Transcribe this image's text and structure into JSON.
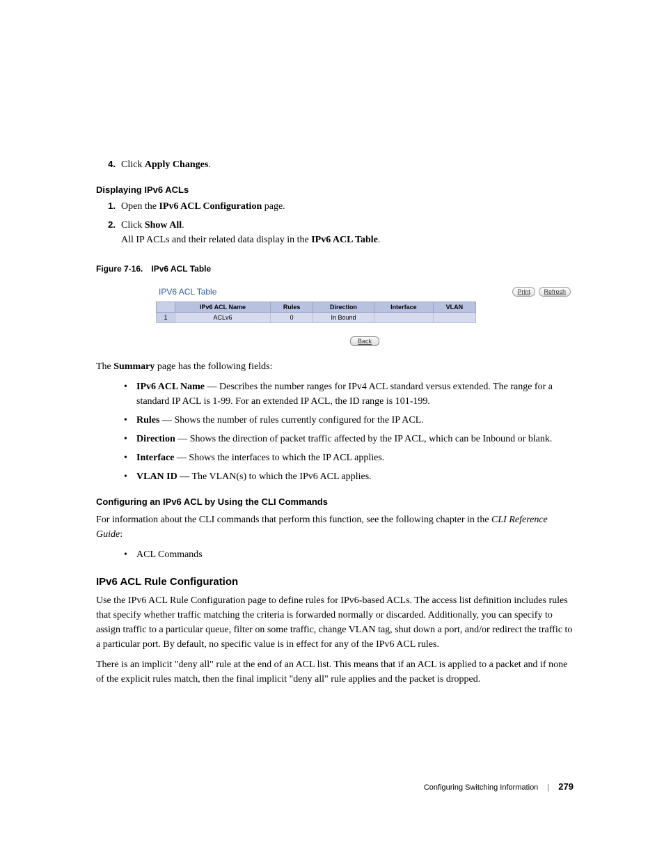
{
  "step4": {
    "num": "4.",
    "pre": "Click ",
    "bold": "Apply Changes",
    "post": "."
  },
  "h_display": "Displaying IPv6 ACLs",
  "ol1": {
    "num": "1.",
    "pre": "Open the ",
    "bold": "IPv6 ACL Configuration",
    "post": " page."
  },
  "ol2": {
    "num": "2.",
    "pre": "Click ",
    "bold": "Show All",
    "post": ".",
    "line2_pre": "All IP ACLs and their related data display in the ",
    "line2_bold": "IPv6 ACL Table",
    "line2_post": "."
  },
  "fig_caption": {
    "label": "Figure 7-16.",
    "title": "IPv6 ACL Table"
  },
  "figure": {
    "title": "IPV6 ACL Table",
    "print": "Print",
    "refresh": "Refresh",
    "headers": {
      "rownum": "",
      "name": "IPv6 ACL Name",
      "rules": "Rules",
      "direction": "Direction",
      "interface": "Interface",
      "vlan": "VLAN"
    },
    "row1": {
      "rownum": "1",
      "name": "ACLv6",
      "rules": "0",
      "direction": "In Bound",
      "interface": "",
      "vlan": ""
    },
    "back": "Back"
  },
  "summary_intro": {
    "pre": "The ",
    "bold": "Summary",
    "post": " page has the following fields:"
  },
  "fields": {
    "name": {
      "b": "IPv6 ACL Name",
      "t": " — Describes the number ranges for IPv4 ACL standard versus extended. The range for a standard IP ACL is 1-99. For an extended IP ACL, the ID range is 101-199."
    },
    "rules": {
      "b": "Rules",
      "t": " — Shows the number of rules currently configured for the IP ACL."
    },
    "direction": {
      "b": "Direction",
      "t": " — Shows the direction of packet traffic affected by the IP ACL, which can be Inbound or blank."
    },
    "interface": {
      "b": "Interface",
      "t": " — Shows the interfaces to which the IP ACL applies."
    },
    "vlan": {
      "b": "VLAN ID",
      "t": " — The VLAN(s) to which the IPv6 ACL applies."
    }
  },
  "h_cli": "Configuring an IPv6 ACL by Using the CLI Commands",
  "cli_para": {
    "pre": "For information about the CLI commands that perform this function, see the following chapter in the ",
    "it": "CLI Reference Guide",
    "post": ":"
  },
  "cli_bullet": "ACL Commands",
  "h_rule": "IPv6 ACL Rule Configuration",
  "rule_p1": "Use the IPv6 ACL Rule Configuration page to define rules for IPv6-based ACLs. The access list definition includes rules that specify whether traffic matching the criteria is forwarded normally or discarded. Additionally, you can specify to assign traffic to a particular queue, filter on some traffic, change VLAN tag, shut down a port, and/or redirect the traffic to a particular port. By default, no specific value is in effect for any of the IPv6 ACL rules.",
  "rule_p2": "There is an implicit \"deny all\" rule at the end of an ACL list. This means that if an ACL is applied to a packet and if none of the explicit rules match, then the final implicit \"deny all\" rule applies and the packet is dropped.",
  "footer": {
    "section": "Configuring Switching Information",
    "page": "279"
  }
}
